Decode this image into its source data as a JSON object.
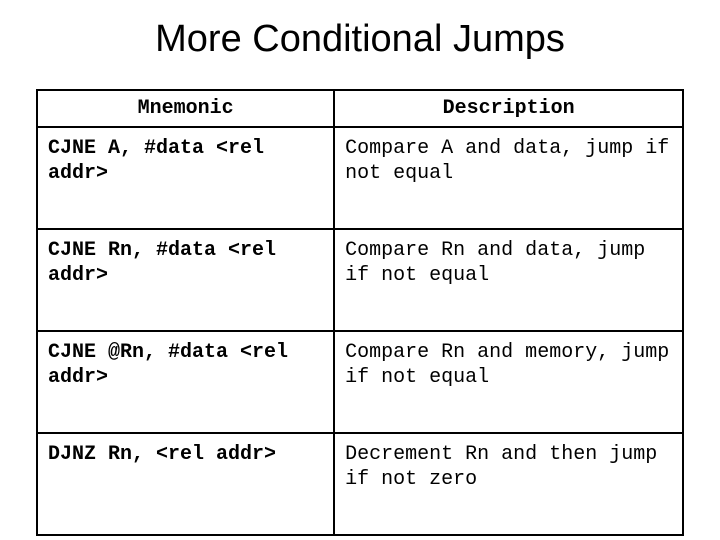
{
  "title": "More Conditional Jumps",
  "headers": {
    "mnemonic": "Mnemonic",
    "description": "Description"
  },
  "rows": [
    {
      "mnemonic": "CJNE A, #data <rel addr>",
      "description": "Compare A and data, jump if not equal"
    },
    {
      "mnemonic": "CJNE Rn, #data <rel addr>",
      "description": "Compare Rn and data, jump if not equal"
    },
    {
      "mnemonic": "CJNE @Rn, #data <rel addr>",
      "description": "Compare Rn and memory, jump if not equal"
    },
    {
      "mnemonic": "DJNZ Rn, <rel addr>",
      "description": "Decrement Rn and then jump if not zero"
    }
  ]
}
